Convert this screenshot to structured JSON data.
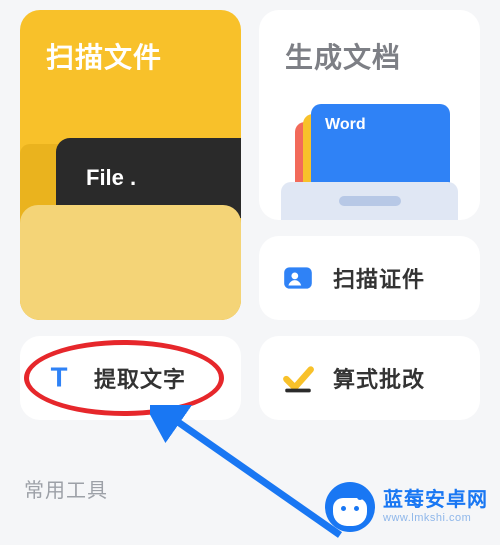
{
  "cards": {
    "scan_files": {
      "title": "扫描文件",
      "file_tab": "File ."
    },
    "gen_doc": {
      "title": "生成文档",
      "page_label": "Word"
    },
    "scan_id": {
      "label": "扫描证件"
    },
    "extract": {
      "label": "提取文字",
      "icon_letter": "T"
    },
    "formula": {
      "label": "算式批改"
    }
  },
  "section": {
    "common_tools": "常用工具"
  },
  "watermark": {
    "name": "蓝莓安卓网",
    "url": "www.lmkshi.com"
  },
  "colors": {
    "accent_yellow": "#f8c12a",
    "accent_blue": "#2f82f6",
    "highlight_red": "#e6272b"
  }
}
